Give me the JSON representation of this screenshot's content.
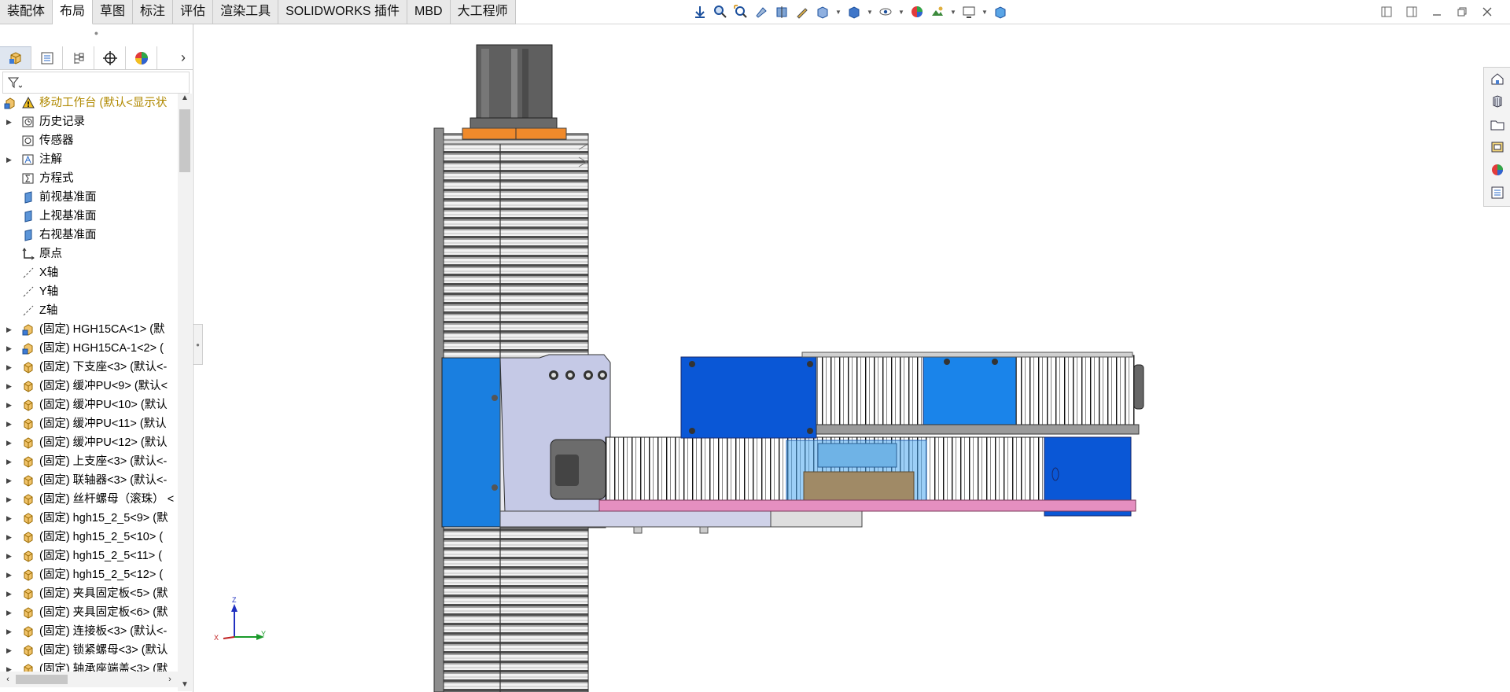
{
  "command_manager": {
    "tabs": [
      {
        "label": "装配体"
      },
      {
        "label": "布局"
      },
      {
        "label": "草图"
      },
      {
        "label": "标注"
      },
      {
        "label": "评估"
      },
      {
        "label": "渲染工具"
      },
      {
        "label": "SOLIDWORKS 插件"
      },
      {
        "label": "MBD"
      },
      {
        "label": "大工程师"
      }
    ],
    "active_tab": "布局"
  },
  "view_toolbar": {
    "icons": [
      "view-orient-icon",
      "zoom-to-fit-icon",
      "zoom-area-icon",
      "previous-view-icon",
      "section-view-icon",
      "dynamic-annotation-icon",
      "view-orientation-icon",
      "display-style-icon",
      "hide-show-icon",
      "edit-appearance-icon",
      "apply-scene-icon",
      "view-settings-icon",
      "display-icon"
    ]
  },
  "feature_manager": {
    "panel_tabs": [
      "feature-manager-icon",
      "property-manager-icon",
      "configuration-manager-icon",
      "dimxpert-icon",
      "display-manager-icon"
    ],
    "root": {
      "label": "移动工作台 (默认<显示状",
      "icon": "warning-icon"
    },
    "items": [
      {
        "label": "历史记录",
        "icon": "history-icon",
        "expandable": true
      },
      {
        "label": "传感器",
        "icon": "sensor-icon",
        "expandable": false
      },
      {
        "label": "注解",
        "icon": "annotation-icon",
        "expandable": true
      },
      {
        "label": "方程式",
        "icon": "equation-icon",
        "expandable": false
      },
      {
        "label": "前视基准面",
        "icon": "plane-icon",
        "expandable": false
      },
      {
        "label": "上视基准面",
        "icon": "plane-icon",
        "expandable": false
      },
      {
        "label": "右视基准面",
        "icon": "plane-icon",
        "expandable": false
      },
      {
        "label": "原点",
        "icon": "origin-icon",
        "expandable": false
      },
      {
        "label": "X轴",
        "icon": "axis-icon",
        "expandable": false
      },
      {
        "label": "Y轴",
        "icon": "axis-icon",
        "expandable": false
      },
      {
        "label": "Z轴",
        "icon": "axis-icon",
        "expandable": false
      },
      {
        "label": "(固定) HGH15CA<1> (默",
        "icon": "subassembly-icon",
        "expandable": true
      },
      {
        "label": "(固定) HGH15CA-1<2> (",
        "icon": "subassembly-icon",
        "expandable": true
      },
      {
        "label": "(固定) 下支座<3> (默认<-",
        "icon": "part-icon",
        "expandable": true
      },
      {
        "label": "(固定) 缓冲PU<9> (默认<",
        "icon": "part-icon",
        "expandable": true
      },
      {
        "label": "(固定) 缓冲PU<10> (默认",
        "icon": "part-icon",
        "expandable": true
      },
      {
        "label": "(固定) 缓冲PU<11> (默认",
        "icon": "part-icon",
        "expandable": true
      },
      {
        "label": "(固定) 缓冲PU<12> (默认",
        "icon": "part-icon",
        "expandable": true
      },
      {
        "label": "(固定) 上支座<3> (默认<-",
        "icon": "part-icon",
        "expandable": true
      },
      {
        "label": "(固定) 联轴器<3> (默认<-",
        "icon": "part-icon",
        "expandable": true
      },
      {
        "label": "(固定) 丝杆螺母（滚珠） <",
        "icon": "part-icon",
        "expandable": true
      },
      {
        "label": "(固定) hgh15_2_5<9> (默",
        "icon": "part-icon",
        "expandable": true
      },
      {
        "label": "(固定) hgh15_2_5<10> (",
        "icon": "part-icon",
        "expandable": true
      },
      {
        "label": "(固定) hgh15_2_5<11> (",
        "icon": "part-icon",
        "expandable": true
      },
      {
        "label": "(固定) hgh15_2_5<12> (",
        "icon": "part-icon",
        "expandable": true
      },
      {
        "label": "(固定) 夹具固定板<5> (默",
        "icon": "part-icon",
        "expandable": true
      },
      {
        "label": "(固定) 夹具固定板<6> (默",
        "icon": "part-icon",
        "expandable": true
      },
      {
        "label": "(固定) 连接板<3> (默认<-",
        "icon": "part-icon",
        "expandable": true
      },
      {
        "label": "(固定) 锁紧螺母<3> (默认",
        "icon": "part-icon",
        "expandable": true
      },
      {
        "label": "(固定) 轴承座端盖<3> (默",
        "icon": "part-icon",
        "expandable": true
      }
    ]
  },
  "task_pane": {
    "icons": [
      "solidworks-resources-icon",
      "design-library-icon",
      "file-explorer-icon",
      "view-palette-icon",
      "appearances-icon",
      "custom-properties-icon"
    ]
  },
  "triad": {
    "x_label": "X",
    "y_label": "Y",
    "z_label": "Z"
  },
  "colors": {
    "blue_block": "#0a57d6",
    "light_blue_block": "#1a84ea",
    "motor_gray": "#5f5f5f",
    "orange_plate": "#f08a2b",
    "pink_plate": "#e58fc0",
    "lavender_bracket": "#c5c9e6"
  }
}
